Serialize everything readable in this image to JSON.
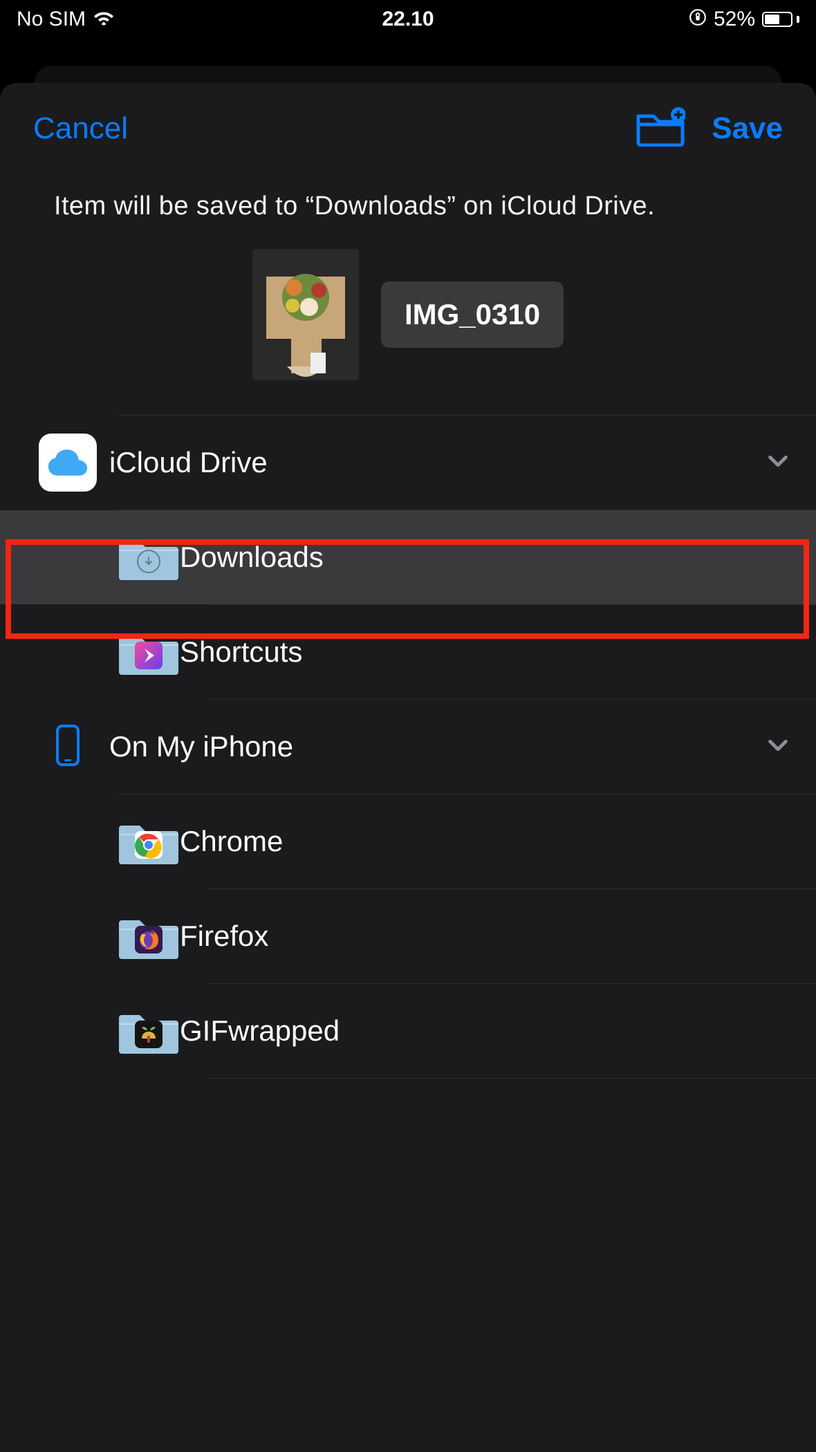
{
  "statusbar": {
    "carrier": "No SIM",
    "time": "22.10",
    "battery_pct": "52%"
  },
  "header": {
    "cancel": "Cancel",
    "save": "Save"
  },
  "info_text": "Item will be saved to “Downloads” on iCloud Drive.",
  "file": {
    "name": "IMG_0310"
  },
  "locations": [
    {
      "name": "iCloud Drive",
      "icon": "icloud",
      "expanded": true,
      "folders": [
        {
          "name": "Downloads",
          "icon": "downloads",
          "selected": true
        },
        {
          "name": "Shortcuts",
          "icon": "shortcuts",
          "selected": false
        }
      ]
    },
    {
      "name": "On My iPhone",
      "icon": "iphone",
      "expanded": true,
      "folders": [
        {
          "name": "Chrome",
          "icon": "chrome",
          "selected": false
        },
        {
          "name": "Firefox",
          "icon": "firefox",
          "selected": false
        },
        {
          "name": "GIFwrapped",
          "icon": "gifwrapped",
          "selected": false
        }
      ]
    }
  ],
  "highlight": {
    "row": "Downloads"
  }
}
